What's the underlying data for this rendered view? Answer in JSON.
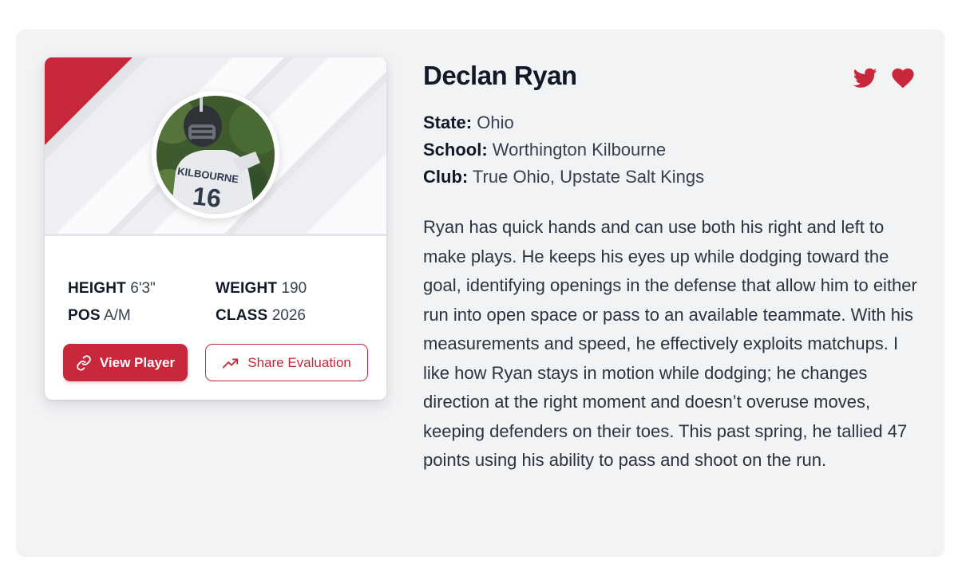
{
  "player": {
    "name": "Declan Ryan",
    "state_label": "State:",
    "state": "Ohio",
    "school_label": "School:",
    "school": "Worthington Kilbourne",
    "club_label": "Club:",
    "club": "True Ohio, Upstate Salt Kings",
    "bio": "Ryan has quick hands and can use both his right and left to make plays. He keeps his eyes up while dodging toward the goal, identifying openings in the defense that allow him to either run into open space or pass to an available teammate. With his measurements and speed, he effectively exploits matchups. I like how Ryan stays in motion while dodging; he changes direction at the right moment and doesn’t overuse moves, keeping defenders on their toes. This past spring, he tallied 47 points using his ability to pass and shoot on the run."
  },
  "stats": {
    "height_label": "HEIGHT",
    "height": "6'3\"",
    "weight_label": "WEIGHT",
    "weight": "190",
    "pos_label": "POS",
    "pos": "A/M",
    "class_label": "CLASS",
    "class": "2026"
  },
  "avatar": {
    "jersey_text": "KILBOURNE",
    "jersey_number": "16"
  },
  "actions": {
    "view_player": "View Player",
    "share_evaluation": "Share Evaluation"
  },
  "icons": {
    "twitter": "twitter-icon",
    "favorite": "heart-icon",
    "link": "link-icon",
    "trend": "trending-up-icon"
  },
  "colors": {
    "accent": "#c8283c",
    "panel_bg": "#f2f3f5",
    "text": "#111827"
  }
}
